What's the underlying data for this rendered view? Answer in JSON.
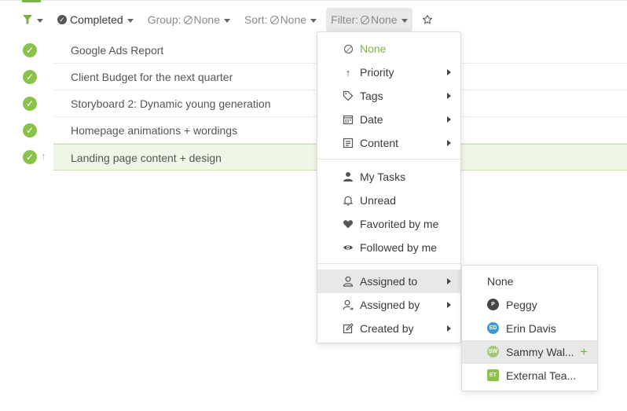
{
  "toolbar": {
    "completed_label": "Completed",
    "group_label": "Group:",
    "group_value": "None",
    "sort_label": "Sort:",
    "sort_value": "None",
    "filter_label": "Filter:",
    "filter_value": "None"
  },
  "tasks": [
    {
      "title": "Google Ads Report"
    },
    {
      "title": "Client Budget for the next quarter"
    },
    {
      "title": "Storyboard 2: Dynamic young generation"
    },
    {
      "title": "Homepage animations + wordings"
    },
    {
      "title": "Landing page content + design"
    }
  ],
  "filter_menu": {
    "none": "None",
    "priority": "Priority",
    "tags": "Tags",
    "date": "Date",
    "content": "Content",
    "my_tasks": "My Tasks",
    "unread": "Unread",
    "favorited": "Favorited by me",
    "followed": "Followed by me",
    "assigned_to": "Assigned to",
    "assigned_by": "Assigned by",
    "created_by": "Created by"
  },
  "assignee_menu": {
    "none": "None",
    "people": [
      {
        "name": "Peggy",
        "initials": "P",
        "color": "#444444"
      },
      {
        "name": "Erin Davis",
        "initials": "ED",
        "color": "#3d9ad1"
      },
      {
        "name": "Sammy Wal...",
        "initials": "SW",
        "color": "#a3c97a"
      },
      {
        "name": "External Tea...",
        "initials": "ET",
        "color": "#8bc34a"
      }
    ]
  },
  "colors": {
    "accent": "#7cb342",
    "check": "#8bc34a",
    "highlight": "#eef7e6"
  }
}
